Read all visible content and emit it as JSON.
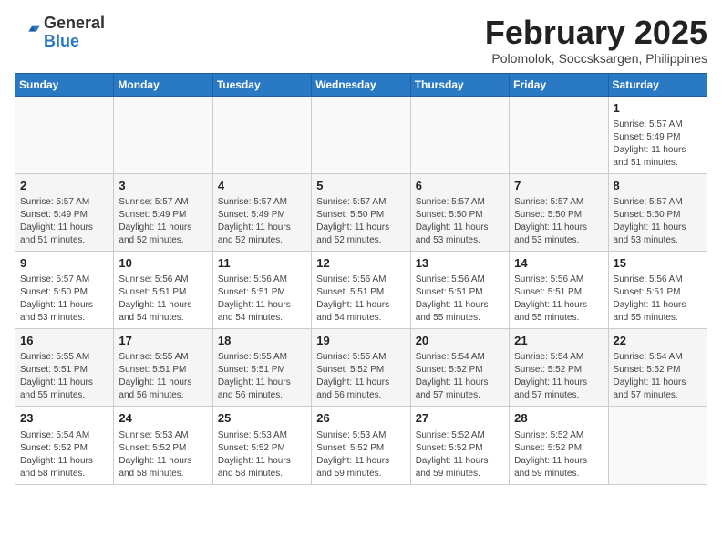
{
  "header": {
    "logo_general": "General",
    "logo_blue": "Blue",
    "title": "February 2025",
    "subtitle": "Polomolok, Soccsksargen, Philippines"
  },
  "days_of_week": [
    "Sunday",
    "Monday",
    "Tuesday",
    "Wednesday",
    "Thursday",
    "Friday",
    "Saturday"
  ],
  "weeks": [
    [
      {
        "day": "",
        "info": ""
      },
      {
        "day": "",
        "info": ""
      },
      {
        "day": "",
        "info": ""
      },
      {
        "day": "",
        "info": ""
      },
      {
        "day": "",
        "info": ""
      },
      {
        "day": "",
        "info": ""
      },
      {
        "day": "1",
        "info": "Sunrise: 5:57 AM\nSunset: 5:49 PM\nDaylight: 11 hours and 51 minutes."
      }
    ],
    [
      {
        "day": "2",
        "info": "Sunrise: 5:57 AM\nSunset: 5:49 PM\nDaylight: 11 hours and 51 minutes."
      },
      {
        "day": "3",
        "info": "Sunrise: 5:57 AM\nSunset: 5:49 PM\nDaylight: 11 hours and 52 minutes."
      },
      {
        "day": "4",
        "info": "Sunrise: 5:57 AM\nSunset: 5:49 PM\nDaylight: 11 hours and 52 minutes."
      },
      {
        "day": "5",
        "info": "Sunrise: 5:57 AM\nSunset: 5:50 PM\nDaylight: 11 hours and 52 minutes."
      },
      {
        "day": "6",
        "info": "Sunrise: 5:57 AM\nSunset: 5:50 PM\nDaylight: 11 hours and 53 minutes."
      },
      {
        "day": "7",
        "info": "Sunrise: 5:57 AM\nSunset: 5:50 PM\nDaylight: 11 hours and 53 minutes."
      },
      {
        "day": "8",
        "info": "Sunrise: 5:57 AM\nSunset: 5:50 PM\nDaylight: 11 hours and 53 minutes."
      }
    ],
    [
      {
        "day": "9",
        "info": "Sunrise: 5:57 AM\nSunset: 5:50 PM\nDaylight: 11 hours and 53 minutes."
      },
      {
        "day": "10",
        "info": "Sunrise: 5:56 AM\nSunset: 5:51 PM\nDaylight: 11 hours and 54 minutes."
      },
      {
        "day": "11",
        "info": "Sunrise: 5:56 AM\nSunset: 5:51 PM\nDaylight: 11 hours and 54 minutes."
      },
      {
        "day": "12",
        "info": "Sunrise: 5:56 AM\nSunset: 5:51 PM\nDaylight: 11 hours and 54 minutes."
      },
      {
        "day": "13",
        "info": "Sunrise: 5:56 AM\nSunset: 5:51 PM\nDaylight: 11 hours and 55 minutes."
      },
      {
        "day": "14",
        "info": "Sunrise: 5:56 AM\nSunset: 5:51 PM\nDaylight: 11 hours and 55 minutes."
      },
      {
        "day": "15",
        "info": "Sunrise: 5:56 AM\nSunset: 5:51 PM\nDaylight: 11 hours and 55 minutes."
      }
    ],
    [
      {
        "day": "16",
        "info": "Sunrise: 5:55 AM\nSunset: 5:51 PM\nDaylight: 11 hours and 55 minutes."
      },
      {
        "day": "17",
        "info": "Sunrise: 5:55 AM\nSunset: 5:51 PM\nDaylight: 11 hours and 56 minutes."
      },
      {
        "day": "18",
        "info": "Sunrise: 5:55 AM\nSunset: 5:51 PM\nDaylight: 11 hours and 56 minutes."
      },
      {
        "day": "19",
        "info": "Sunrise: 5:55 AM\nSunset: 5:52 PM\nDaylight: 11 hours and 56 minutes."
      },
      {
        "day": "20",
        "info": "Sunrise: 5:54 AM\nSunset: 5:52 PM\nDaylight: 11 hours and 57 minutes."
      },
      {
        "day": "21",
        "info": "Sunrise: 5:54 AM\nSunset: 5:52 PM\nDaylight: 11 hours and 57 minutes."
      },
      {
        "day": "22",
        "info": "Sunrise: 5:54 AM\nSunset: 5:52 PM\nDaylight: 11 hours and 57 minutes."
      }
    ],
    [
      {
        "day": "23",
        "info": "Sunrise: 5:54 AM\nSunset: 5:52 PM\nDaylight: 11 hours and 58 minutes."
      },
      {
        "day": "24",
        "info": "Sunrise: 5:53 AM\nSunset: 5:52 PM\nDaylight: 11 hours and 58 minutes."
      },
      {
        "day": "25",
        "info": "Sunrise: 5:53 AM\nSunset: 5:52 PM\nDaylight: 11 hours and 58 minutes."
      },
      {
        "day": "26",
        "info": "Sunrise: 5:53 AM\nSunset: 5:52 PM\nDaylight: 11 hours and 59 minutes."
      },
      {
        "day": "27",
        "info": "Sunrise: 5:52 AM\nSunset: 5:52 PM\nDaylight: 11 hours and 59 minutes."
      },
      {
        "day": "28",
        "info": "Sunrise: 5:52 AM\nSunset: 5:52 PM\nDaylight: 11 hours and 59 minutes."
      },
      {
        "day": "",
        "info": ""
      }
    ]
  ]
}
